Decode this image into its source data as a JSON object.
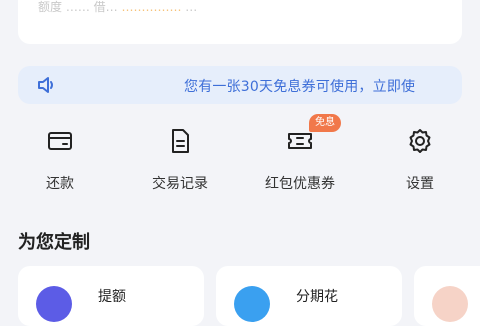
{
  "top": {
    "line_gray": "额度 …… 借… ",
    "line_highlight": "…………… ",
    "line_tail": "…"
  },
  "notice": {
    "icon": "speaker-icon",
    "text": "您有一张30天免息券可使用，立即使"
  },
  "quick_actions": [
    {
      "label": "还款",
      "icon": "wallet-icon"
    },
    {
      "label": "交易记录",
      "icon": "document-icon"
    },
    {
      "label": "红包优惠券",
      "icon": "coupon-icon",
      "badge": "免息"
    },
    {
      "label": "设置",
      "icon": "gear-icon"
    }
  ],
  "section": {
    "title": "为您定制"
  },
  "custom_cards": [
    {
      "title": "提额",
      "avatar_color": "#5c5ce6"
    },
    {
      "title": "分期花",
      "avatar_color": "#3aa0f0"
    },
    {
      "title": "",
      "avatar_color": "#f6d3c7"
    }
  ]
}
